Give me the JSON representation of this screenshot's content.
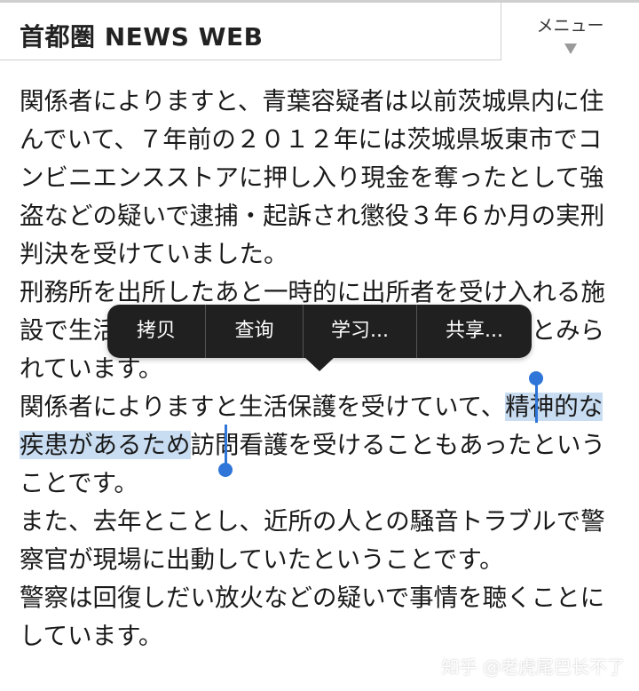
{
  "header": {
    "site_title": "首都圏 NEWS WEB",
    "menu_label": "メニュー"
  },
  "article": {
    "paragraphs": [
      {
        "text": "関係者によりますと、青葉容疑者は以前茨城県内に住んでいて、７年前の２０１２年には茨城県坂東市でコンビニエンスストアに押し入り現金を奪ったとして強盗などの疑いで逮捕・起訴され懲役３年６か月の実刑判決を受けていました。"
      },
      {
        "text": "刑務所を出所したあと一時的に出所者を受け入れる施設で生活したのち、さいたま市内に引っ越したとみられています。"
      },
      {
        "before": "関係者によりますと生活保護を受けていて、",
        "selected": "精神的な疾患があるため",
        "after": "訪問看護を受けることもあったということです。"
      },
      {
        "text": "また、去年とことし、近所の人との騒音トラブルで警察官が現場に出動していたということです。"
      },
      {
        "text": "警察は回復しだい放火などの疑いで事情を聴くことにしています。"
      }
    ]
  },
  "context_menu": {
    "items": [
      "拷贝",
      "查询",
      "学习...",
      "共享..."
    ]
  },
  "watermark": "知乎 @老虎尾巴长不了",
  "colors": {
    "selection": "#c9ddf2",
    "selection_handle": "#2f76d8",
    "menu_bg": "#202020"
  }
}
